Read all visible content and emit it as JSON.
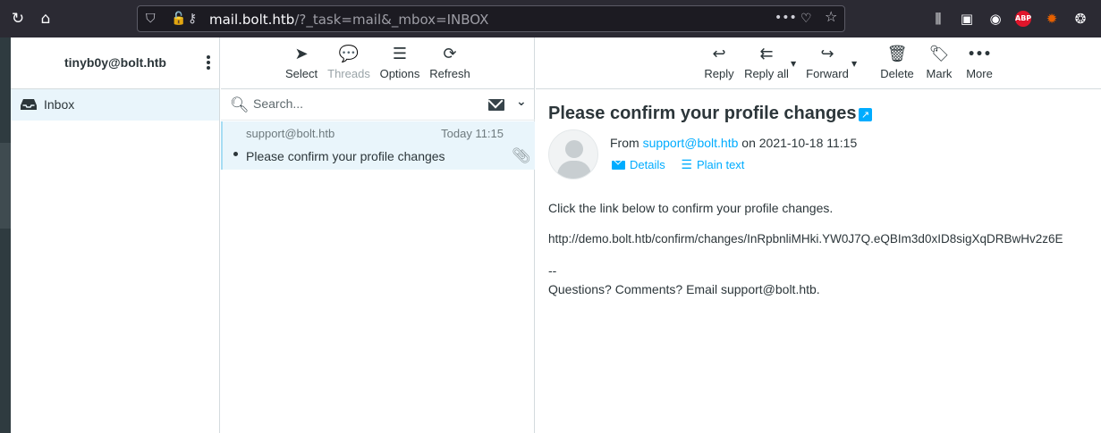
{
  "browser": {
    "url_host": "mail.bolt.htb",
    "url_path": "/?_task=mail&_mbox=INBOX",
    "abp_label": "ABP"
  },
  "account": {
    "username": "tinyb0y@bolt.htb"
  },
  "folders": [
    {
      "label": "Inbox",
      "selected": true
    }
  ],
  "list_toolbar": {
    "select_label": "Select",
    "threads_label": "Threads",
    "options_label": "Options",
    "refresh_label": "Refresh"
  },
  "search": {
    "placeholder": "Search..."
  },
  "messages": [
    {
      "from": "support@bolt.htb",
      "date": "Today 11:15",
      "subject": "Please confirm your profile changes",
      "unread": true,
      "has_attachment": true
    }
  ],
  "view_toolbar": {
    "reply_label": "Reply",
    "reply_all_label": "Reply all",
    "forward_label": "Forward",
    "delete_label": "Delete",
    "mark_label": "Mark",
    "more_label": "More"
  },
  "message": {
    "title": "Please confirm your profile changes",
    "from_prefix": "From",
    "from_address": "support@bolt.htb",
    "date_text": "on 2021-10-18 11:15",
    "details_label": "Details",
    "plaintext_label": "Plain text",
    "body_line1": "Click the link below to confirm your profile changes.",
    "link": "http://demo.bolt.htb/confirm/changes/InRpbnliMHki.YW0J7Q.eQBIm3d0xID8sigXqDRBwHv2z6E",
    "signature_sep": "--",
    "signature": "Questions? Comments? Email support@bolt.htb."
  },
  "colors": {
    "accent": "#00acff",
    "selected_bg": "#e9f5fb",
    "browser_bg": "#2b2a33",
    "left_edge": "#2f3b40"
  }
}
